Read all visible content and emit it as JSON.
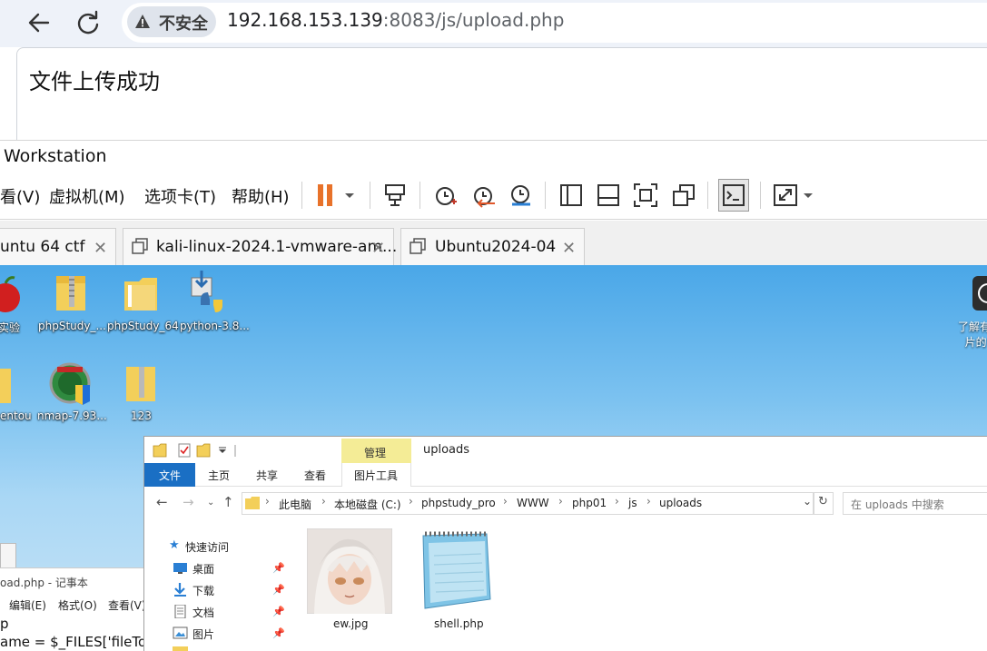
{
  "browser": {
    "security_label": "不安全",
    "url_host": "192.168.153.139",
    "url_rest": ":8083/js/upload.php"
  },
  "page": {
    "message": "文件上传成功"
  },
  "vmware": {
    "title": "Workstation",
    "menu": [
      "看(V)",
      "虚拟机(M)",
      "选项卡(T)",
      "帮助(H)"
    ],
    "toolbar_icons": [
      "pause-icon",
      "dropdown-icon",
      "send-ctrl-alt-del-icon",
      "snapshot-icon",
      "revert-snapshot-icon",
      "snapshot-manager-icon",
      "sidebar-icon",
      "thumbnail-bar-icon",
      "fullscreen-icon",
      "unity-icon",
      "console-icon",
      "stretch-icon",
      "dropdown-icon"
    ],
    "tabs": [
      {
        "label": "untu 64 ctf"
      },
      {
        "label": "kali-linux-2024.1-vmware-am..."
      },
      {
        "label": "Ubuntu2024-04"
      }
    ],
    "pause_color": "#e8722a"
  },
  "desktop": {
    "icons": [
      {
        "label": "实验"
      },
      {
        "label": "phpStudy_..."
      },
      {
        "label": "phpStudy_64"
      },
      {
        "label": "python-3.8..."
      },
      {
        "label": "entou"
      },
      {
        "label": "nmap-7.93..."
      },
      {
        "label": "123"
      }
    ],
    "right_label_1": "了解有",
    "right_label_2": "片的"
  },
  "notepad": {
    "title": "oad.php - 记事本",
    "menu_edit": "编辑(E)",
    "menu_format": "格式(O)",
    "menu_view": "查看(V)",
    "line1": "p",
    "line2": "ame = $_FILES['fileTo"
  },
  "explorer": {
    "window_title": "uploads",
    "manage_label": "管理",
    "ribbon": {
      "file": "文件",
      "home": "主页",
      "share": "共享",
      "view": "查看",
      "picture_tools": "图片工具"
    },
    "breadcrumb": [
      "此电脑",
      "本地磁盘 (C:)",
      "phpstudy_pro",
      "WWW",
      "php01",
      "js",
      "uploads"
    ],
    "search_placeholder": "在 uploads 中搜索",
    "nav": {
      "quick_access": "快速访问",
      "desktop": "桌面",
      "downloads": "下载",
      "documents": "文档",
      "pictures": "图片"
    },
    "files": [
      {
        "name": "ew.jpg"
      },
      {
        "name": "shell.php"
      }
    ]
  }
}
